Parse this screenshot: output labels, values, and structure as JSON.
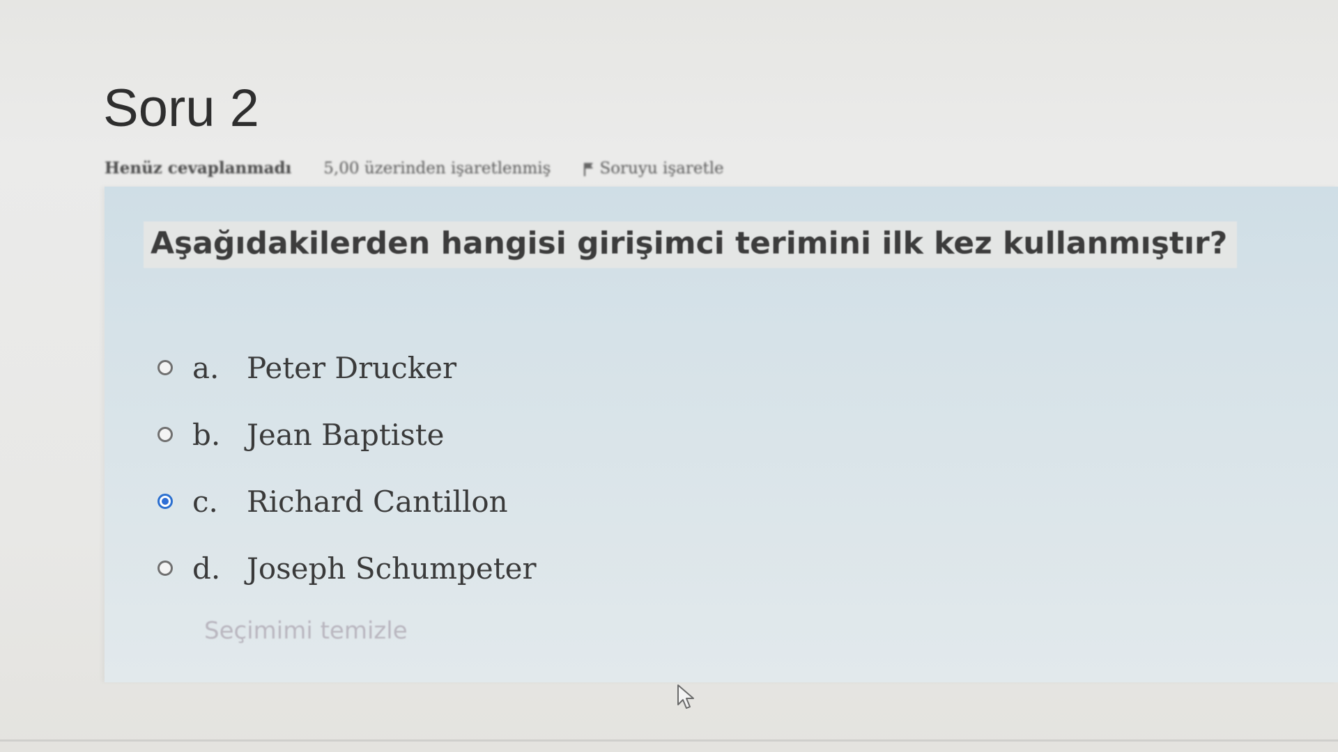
{
  "question": {
    "title": "Soru 2",
    "status": "Henüz cevaplanmadı",
    "marks": "5,00 üzerinden işaretlenmiş",
    "flag_label": "Soruyu işaretle",
    "text": "Aşağıdakilerden hangisi girişimci terimini ilk kez kullanmıştır?",
    "options": [
      {
        "letter": "a.",
        "label": "Peter Drucker",
        "selected": false
      },
      {
        "letter": "b.",
        "label": "Jean Baptiste",
        "selected": false
      },
      {
        "letter": "c.",
        "label": "Richard Cantillon",
        "selected": true
      },
      {
        "letter": "d.",
        "label": "Joseph Schumpeter",
        "selected": false
      }
    ],
    "clear_label": "Seçimimi temizle"
  },
  "icons": {
    "flag": "flag-icon",
    "cursor": "mouse-pointer-icon"
  },
  "colors": {
    "selected_radio": "#2f6fd6",
    "question_box": "#d6e2e8",
    "clear_link": "#b9b6bf"
  }
}
